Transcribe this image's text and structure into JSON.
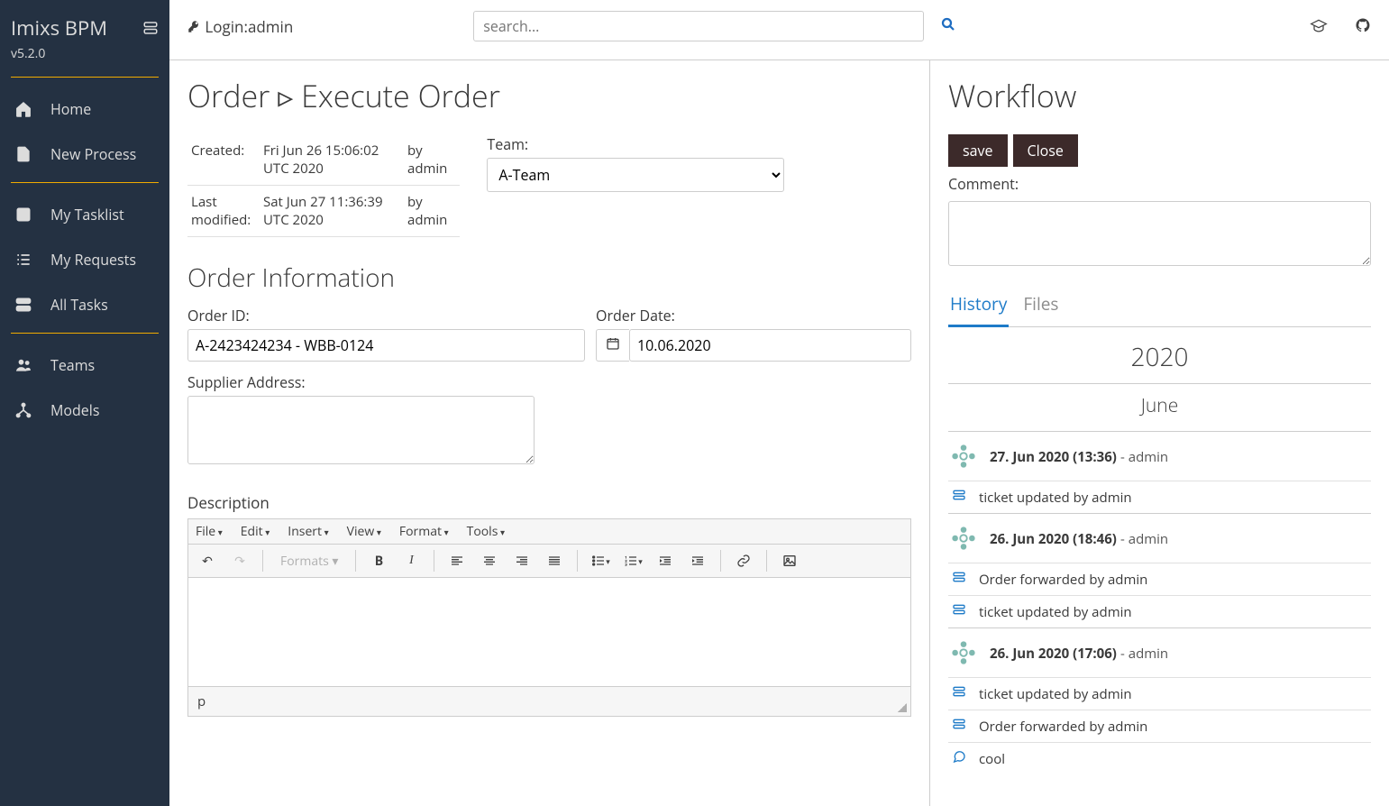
{
  "app": {
    "name": "Imixs BPM",
    "version": "v5.2.0"
  },
  "login_prefix": "Login: ",
  "login_user": "admin",
  "search_placeholder": "search...",
  "nav": {
    "home": "Home",
    "new_process": "New Process",
    "my_tasklist": "My Tasklist",
    "my_requests": "My Requests",
    "all_tasks": "All Tasks",
    "teams": "Teams",
    "models": "Models"
  },
  "page_title": "Order ▹ Execute Order",
  "meta": {
    "created_label": "Created:",
    "created_value": "Fri Jun 26 15:06:02 UTC 2020",
    "created_by_label": "by",
    "created_by": "admin",
    "modified_label": "Last modified:",
    "modified_value": "Sat Jun 27 11:36:39 UTC 2020",
    "modified_by_label": "by",
    "modified_by": "admin"
  },
  "team_label": "Team:",
  "team_value": "A-Team",
  "section_order_info": "Order Information",
  "order_id_label": "Order ID:",
  "order_id_value": "A-2423424234 - WBB-0124",
  "order_date_label": "Order Date:",
  "order_date_value": "10.06.2020",
  "supplier_label": "Supplier Address:",
  "supplier_value": "",
  "description_label": "Description",
  "editor_menu": {
    "file": "File",
    "edit": "Edit",
    "insert": "Insert",
    "view": "View",
    "format": "Format",
    "tools": "Tools"
  },
  "editor_formats": "Formats",
  "editor_status": "p",
  "workflow_title": "Workflow",
  "btn_save": "save",
  "btn_close": "Close",
  "comment_label": "Comment:",
  "tab_history": "History",
  "tab_files": "Files",
  "history": {
    "year": "2020",
    "month": "June",
    "entries": [
      {
        "type": "head",
        "time": "27. Jun 2020 (13:36)",
        "user": "admin"
      },
      {
        "type": "event",
        "icon": "server",
        "text": "ticket updated by admin"
      },
      {
        "type": "head",
        "time": "26. Jun 2020 (18:46)",
        "user": "admin"
      },
      {
        "type": "event",
        "icon": "server",
        "text": "Order forwarded by admin"
      },
      {
        "type": "event",
        "icon": "server",
        "text": "ticket updated by admin"
      },
      {
        "type": "head",
        "time": "26. Jun 2020 (17:06)",
        "user": "admin"
      },
      {
        "type": "event",
        "icon": "server",
        "text": "ticket updated by admin"
      },
      {
        "type": "event",
        "icon": "server",
        "text": "Order forwarded by admin"
      },
      {
        "type": "event",
        "icon": "comment",
        "text": "cool"
      }
    ]
  }
}
